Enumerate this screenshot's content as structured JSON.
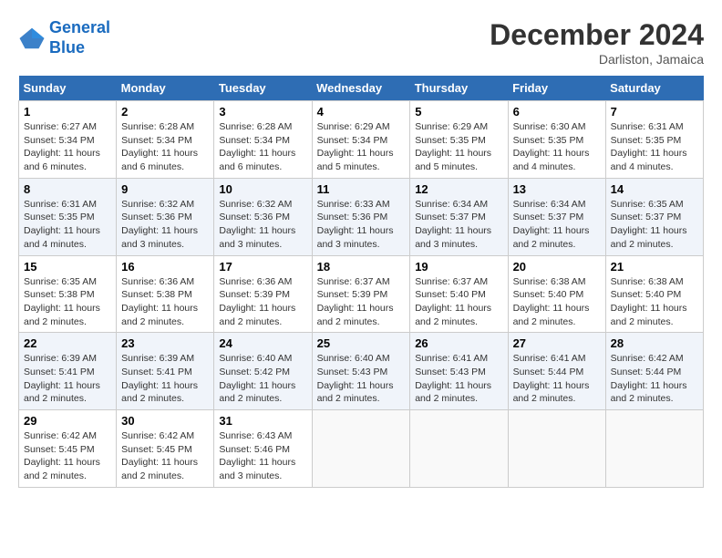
{
  "header": {
    "logo_line1": "General",
    "logo_line2": "Blue",
    "month": "December 2024",
    "location": "Darliston, Jamaica"
  },
  "weekdays": [
    "Sunday",
    "Monday",
    "Tuesday",
    "Wednesday",
    "Thursday",
    "Friday",
    "Saturday"
  ],
  "weeks": [
    [
      {
        "day": "1",
        "sunrise": "6:27 AM",
        "sunset": "5:34 PM",
        "daylight": "11 hours and 6 minutes."
      },
      {
        "day": "2",
        "sunrise": "6:28 AM",
        "sunset": "5:34 PM",
        "daylight": "11 hours and 6 minutes."
      },
      {
        "day": "3",
        "sunrise": "6:28 AM",
        "sunset": "5:34 PM",
        "daylight": "11 hours and 6 minutes."
      },
      {
        "day": "4",
        "sunrise": "6:29 AM",
        "sunset": "5:34 PM",
        "daylight": "11 hours and 5 minutes."
      },
      {
        "day": "5",
        "sunrise": "6:29 AM",
        "sunset": "5:35 PM",
        "daylight": "11 hours and 5 minutes."
      },
      {
        "day": "6",
        "sunrise": "6:30 AM",
        "sunset": "5:35 PM",
        "daylight": "11 hours and 4 minutes."
      },
      {
        "day": "7",
        "sunrise": "6:31 AM",
        "sunset": "5:35 PM",
        "daylight": "11 hours and 4 minutes."
      }
    ],
    [
      {
        "day": "8",
        "sunrise": "6:31 AM",
        "sunset": "5:35 PM",
        "daylight": "11 hours and 4 minutes."
      },
      {
        "day": "9",
        "sunrise": "6:32 AM",
        "sunset": "5:36 PM",
        "daylight": "11 hours and 3 minutes."
      },
      {
        "day": "10",
        "sunrise": "6:32 AM",
        "sunset": "5:36 PM",
        "daylight": "11 hours and 3 minutes."
      },
      {
        "day": "11",
        "sunrise": "6:33 AM",
        "sunset": "5:36 PM",
        "daylight": "11 hours and 3 minutes."
      },
      {
        "day": "12",
        "sunrise": "6:34 AM",
        "sunset": "5:37 PM",
        "daylight": "11 hours and 3 minutes."
      },
      {
        "day": "13",
        "sunrise": "6:34 AM",
        "sunset": "5:37 PM",
        "daylight": "11 hours and 2 minutes."
      },
      {
        "day": "14",
        "sunrise": "6:35 AM",
        "sunset": "5:37 PM",
        "daylight": "11 hours and 2 minutes."
      }
    ],
    [
      {
        "day": "15",
        "sunrise": "6:35 AM",
        "sunset": "5:38 PM",
        "daylight": "11 hours and 2 minutes."
      },
      {
        "day": "16",
        "sunrise": "6:36 AM",
        "sunset": "5:38 PM",
        "daylight": "11 hours and 2 minutes."
      },
      {
        "day": "17",
        "sunrise": "6:36 AM",
        "sunset": "5:39 PM",
        "daylight": "11 hours and 2 minutes."
      },
      {
        "day": "18",
        "sunrise": "6:37 AM",
        "sunset": "5:39 PM",
        "daylight": "11 hours and 2 minutes."
      },
      {
        "day": "19",
        "sunrise": "6:37 AM",
        "sunset": "5:40 PM",
        "daylight": "11 hours and 2 minutes."
      },
      {
        "day": "20",
        "sunrise": "6:38 AM",
        "sunset": "5:40 PM",
        "daylight": "11 hours and 2 minutes."
      },
      {
        "day": "21",
        "sunrise": "6:38 AM",
        "sunset": "5:40 PM",
        "daylight": "11 hours and 2 minutes."
      }
    ],
    [
      {
        "day": "22",
        "sunrise": "6:39 AM",
        "sunset": "5:41 PM",
        "daylight": "11 hours and 2 minutes."
      },
      {
        "day": "23",
        "sunrise": "6:39 AM",
        "sunset": "5:41 PM",
        "daylight": "11 hours and 2 minutes."
      },
      {
        "day": "24",
        "sunrise": "6:40 AM",
        "sunset": "5:42 PM",
        "daylight": "11 hours and 2 minutes."
      },
      {
        "day": "25",
        "sunrise": "6:40 AM",
        "sunset": "5:43 PM",
        "daylight": "11 hours and 2 minutes."
      },
      {
        "day": "26",
        "sunrise": "6:41 AM",
        "sunset": "5:43 PM",
        "daylight": "11 hours and 2 minutes."
      },
      {
        "day": "27",
        "sunrise": "6:41 AM",
        "sunset": "5:44 PM",
        "daylight": "11 hours and 2 minutes."
      },
      {
        "day": "28",
        "sunrise": "6:42 AM",
        "sunset": "5:44 PM",
        "daylight": "11 hours and 2 minutes."
      }
    ],
    [
      {
        "day": "29",
        "sunrise": "6:42 AM",
        "sunset": "5:45 PM",
        "daylight": "11 hours and 2 minutes."
      },
      {
        "day": "30",
        "sunrise": "6:42 AM",
        "sunset": "5:45 PM",
        "daylight": "11 hours and 2 minutes."
      },
      {
        "day": "31",
        "sunrise": "6:43 AM",
        "sunset": "5:46 PM",
        "daylight": "11 hours and 3 minutes."
      },
      null,
      null,
      null,
      null
    ]
  ],
  "labels": {
    "sunrise": "Sunrise:",
    "sunset": "Sunset:",
    "daylight": "Daylight:"
  }
}
